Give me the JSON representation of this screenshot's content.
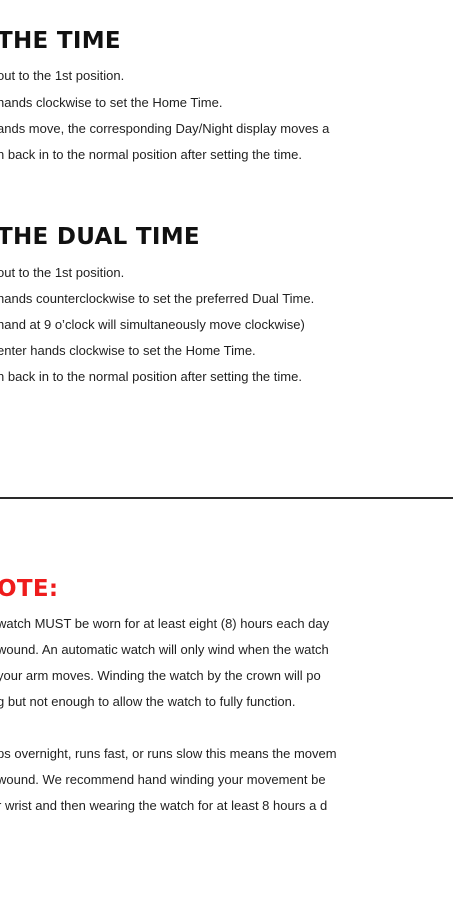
{
  "sections": {
    "set_time": {
      "heading": "THE TIME",
      "lines": [
        "out to the 1st position.",
        " hands clockwise to set the Home Time.",
        "ands move, the corresponding Day/Night display moves a",
        "n back in to the normal position after setting the time."
      ]
    },
    "dual_time": {
      "heading": "THE DUAL TIME",
      "lines": [
        "out to the 1st position.",
        " hands counterclockwise to set the preferred Dual Time.",
        " hand at 9 o’clock will simultaneously move clockwise)",
        "enter hands clockwise to set the Home Time.",
        "n back in to the normal position after setting the time."
      ]
    },
    "note": {
      "heading": "OTE:",
      "paragraph1": [
        "watch MUST be worn for at least eight (8) hours each day",
        "wound. An automatic watch will only wind when the watch",
        " your arm moves. Winding the watch by the crown will po",
        "g but not enough to allow the watch to fully function."
      ],
      "paragraph2": [
        "ps overnight, runs fast, or runs slow this means the movem",
        "wound. We recommend hand winding your movement be",
        "r wrist and then wearing the watch for at least 8 hours a d"
      ]
    }
  },
  "colors": {
    "note_heading": "#ee1c1c",
    "text": "#1f1f1f",
    "divider": "#2a2a2a"
  }
}
